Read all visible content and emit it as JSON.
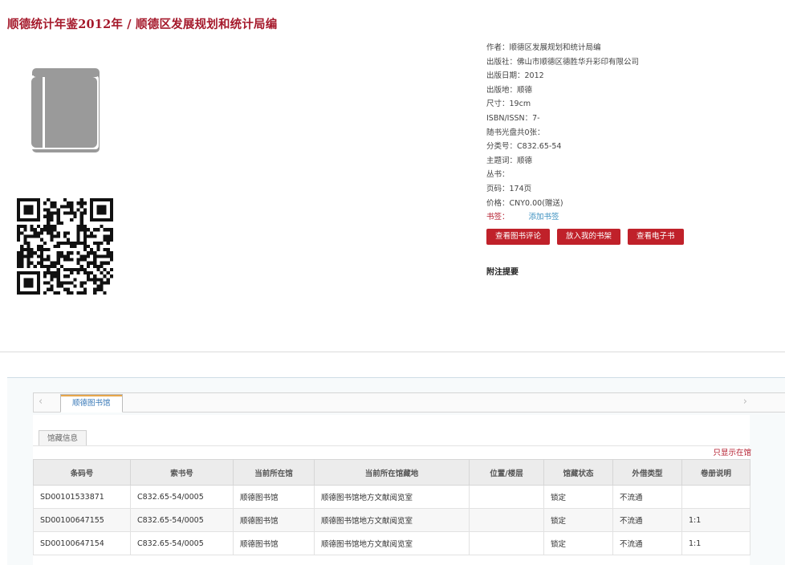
{
  "page": {
    "title": "顺德统计年鉴2012年 / 顺德区发展规划和统计局编"
  },
  "meta": [
    {
      "label": "作者：",
      "value": "顺德区发展规划和统计局编"
    },
    {
      "label": "出版社：",
      "value": "佛山市顺德区德胜华升彩印有限公司"
    },
    {
      "label": "出版日期：",
      "value": "2012"
    },
    {
      "label": "出版地：",
      "value": "顺德"
    },
    {
      "label": "尺寸：",
      "value": "19cm"
    },
    {
      "label": "ISBN/ISSN：",
      "value": "7-"
    },
    {
      "label": "随书光盘共0张：",
      "value": ""
    },
    {
      "label": "分类号：",
      "value": "C832.65-54"
    },
    {
      "label": "主题词：",
      "value": "顺德"
    },
    {
      "label": "丛书：",
      "value": ""
    },
    {
      "label": "页码：",
      "value": "174页"
    },
    {
      "label": "价格：",
      "value": "CNY0.00(赠送)"
    }
  ],
  "bookmark": {
    "label": "书签：",
    "link": "添加书签"
  },
  "actions": {
    "review": "查看图书评论",
    "shelf": "放入我的书架",
    "ebook": "查看电子书"
  },
  "abstract_heading": "附注提要",
  "library_tab": "顺德图书馆",
  "holdings": {
    "subtab": "馆藏信息",
    "only_show_link": "只显示在馆",
    "columns": [
      "条码号",
      "索书号",
      "当前所在馆",
      "当前所在馆藏地",
      "位置/楼层",
      "馆藏状态",
      "外借类型",
      "卷册说明"
    ],
    "rows": [
      [
        "SD00101533871",
        "C832.65-54/0005",
        "顺德图书馆",
        "顺德图书馆地方文献阅览室",
        "",
        "锁定",
        "不流通",
        ""
      ],
      [
        "SD00100647155",
        "C832.65-54/0005",
        "顺德图书馆",
        "顺德图书馆地方文献阅览室",
        "",
        "锁定",
        "不流通",
        "1:1"
      ],
      [
        "SD00100647154",
        "C832.65-54/0005",
        "顺德图书馆",
        "顺德图书馆地方文献阅览室",
        "",
        "锁定",
        "不流通",
        "1:1"
      ]
    ]
  },
  "icons": {
    "book": "book-icon",
    "qr": "qr-code",
    "prev": "chevron-left-icon",
    "next": "chevron-right-icon"
  },
  "colors": {
    "accent": "#c0212a",
    "title": "#a5192b",
    "link": "#3a8fbf"
  }
}
